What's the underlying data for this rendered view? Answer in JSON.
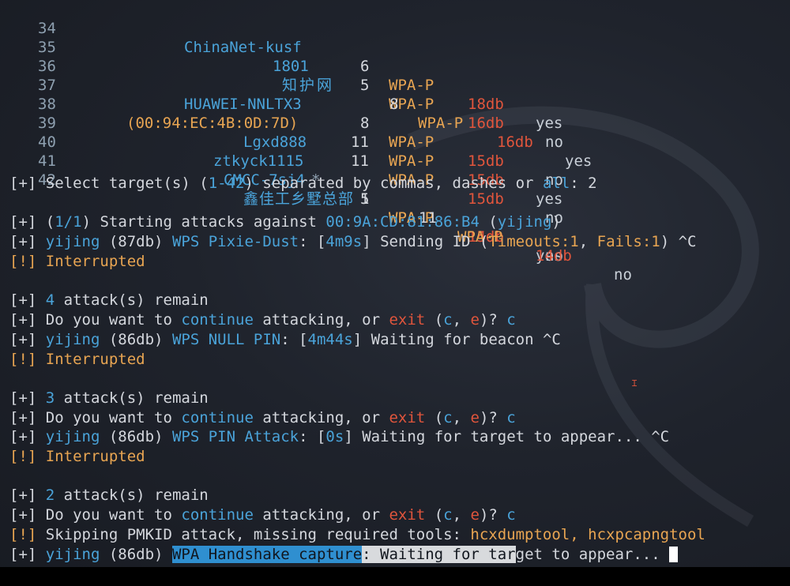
{
  "table_rows": [
    {
      "num": "34",
      "essid": "ChinaNet-kusf",
      "ch": "6",
      "enc": "WPA-P",
      "power": "18db",
      "wps": "yes"
    },
    {
      "num": "35",
      "essid": "1801",
      "ch": "5",
      "enc": "WPA-P",
      "power": "16db",
      "wps": "no"
    },
    {
      "num": "36",
      "essid": "知护网",
      "ch": "8",
      "enc": "WPA-P",
      "power": "16db",
      "wps": "yes"
    },
    {
      "num": "37",
      "essid": "HUAWEI-NNLTX3",
      "ch": "8",
      "enc": "WPA-P",
      "power": "15db",
      "wps": "no"
    },
    {
      "num": "38",
      "essid": "(00:94:EC:4B:0D:7D)",
      "ch": "11",
      "enc": "WPA-P",
      "power": "15db",
      "wps": "yes"
    },
    {
      "num": "39",
      "essid": "Lgxd888",
      "ch": "11",
      "enc": "WPA-P",
      "power": "15db",
      "wps": "no"
    },
    {
      "num": "40",
      "essid": "ztkyck1115",
      "essid_mark": "*",
      "ch": "1",
      "enc": "WPA-P",
      "power": "15db",
      "wps": "no"
    },
    {
      "num": "41",
      "essid": "CMCC-7sj4",
      "ch": "5",
      "enc": "WPA-P",
      "power": "14db",
      "wps": "yes"
    },
    {
      "num": "42",
      "essid": "鑫佳工乡墅总部",
      "ch": "11",
      "enc": "WPA-P",
      "power": "14db",
      "wps": "no"
    }
  ],
  "log": {
    "prefix_plus": "[+]",
    "prefix_bang": "[!]",
    "select": {
      "a": "Select target(s) (",
      "b": "1-42",
      "c": ") separated by commas, dashes or ",
      "d": "all",
      "e": ": 2"
    },
    "start": {
      "a": "(",
      "b": "1/1",
      "c": ") Starting attacks against ",
      "d": "00:9A:CD:81:86:B4",
      "e": " (",
      "f": "yijing",
      "g": ")"
    },
    "pixie": {
      "a": "yijing",
      "b": " (87db) ",
      "c": "WPS Pixie-Dust",
      "d": ": [",
      "e": "4m9s",
      "f": "] Sending ID (",
      "g": "Timeouts:1",
      "h": ", ",
      "i": "Fails:1",
      "j": ") ^C"
    },
    "interrupted": "Interrupted",
    "remain4": {
      "a": "4",
      "b": " attack(s) remain"
    },
    "continue1": {
      "a": "Do you want to ",
      "b": "continue",
      "c": " attacking, or ",
      "d": "exit",
      "e": " (",
      "f": "c",
      "g": ", ",
      "h": "e",
      "i": ")? ",
      "j": "c"
    },
    "null": {
      "a": "yijing",
      "b": " (86db) ",
      "c": "WPS NULL PIN",
      "d": ": [",
      "e": "4m44s",
      "f": "] Waiting for beacon ^C"
    },
    "remain3": {
      "a": "3",
      "b": " attack(s) remain"
    },
    "pin": {
      "a": "yijing",
      "b": " (86db) ",
      "c": "WPS PIN Attack",
      "d": ": [",
      "e": "0s",
      "f": "] Waiting for target to appear... ^C"
    },
    "remain2": {
      "a": "2",
      "b": " attack(s) remain"
    },
    "pmkid": {
      "a": "Skipping PMKID attack, missing required tools: ",
      "b": "hcxdumptool, hcxpcapngtool"
    },
    "handshake": {
      "a": "yijing",
      "b": " (86db) ",
      "c": "WPA Handshake capture",
      "d": ": Waiting for tar",
      "e": "get to appear... "
    }
  },
  "colors": {
    "blue": "#4aa3d9",
    "orange": "#e8a552",
    "red": "#e0553c",
    "text": "#d4d7dd"
  }
}
